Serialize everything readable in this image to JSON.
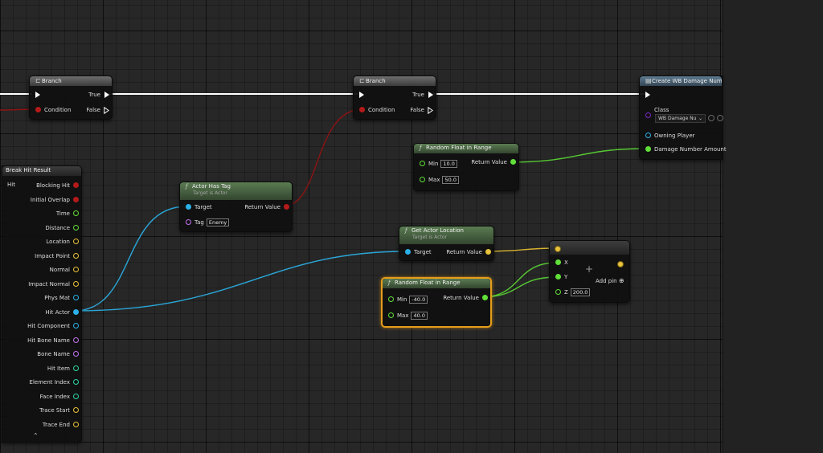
{
  "nodes": {
    "branch1": {
      "title": "Branch",
      "true_label": "True",
      "false_label": "False",
      "condition_label": "Condition"
    },
    "branch2": {
      "title": "Branch",
      "true_label": "True",
      "false_label": "False",
      "condition_label": "Condition"
    },
    "create_widget": {
      "title": "Create WB Damage Numb",
      "class_label": "Class",
      "class_value": "WB Damage Nu",
      "owning_player_label": "Owning Player",
      "damage_amount_label": "Damage Number Amount"
    },
    "random_float_1": {
      "title": "Random Float in Range",
      "min_label": "Min",
      "min_value": "10.0",
      "max_label": "Max",
      "max_value": "50.0",
      "return_label": "Return Value"
    },
    "break_hit_result": {
      "title": "Break Hit Result",
      "input_label": "Hit",
      "outputs": [
        "Blocking Hit",
        "Initial Overlap",
        "Time",
        "Distance",
        "Location",
        "Impact Point",
        "Normal",
        "Impact Normal",
        "Phys Mat",
        "Hit Actor",
        "Hit Component",
        "Hit Bone Name",
        "Bone Name",
        "Hit Item",
        "Element Index",
        "Face Index",
        "Trace Start",
        "Trace End"
      ],
      "collapse_glyph": "⌃"
    },
    "actor_has_tag": {
      "title": "Actor Has Tag",
      "subtitle": "Target is Actor",
      "target_label": "Target",
      "tag_label": "Tag",
      "tag_value": "Enemy",
      "return_label": "Return Value"
    },
    "get_actor_location": {
      "title": "Get Actor Location",
      "subtitle": "Target is Actor",
      "target_label": "Target",
      "return_label": "Return Value"
    },
    "random_float_2": {
      "title": "Random Float in Range",
      "min_label": "Min",
      "min_value": "-40.0",
      "max_label": "Max",
      "max_value": "40.0",
      "return_label": "Return Value"
    },
    "make_vector": {
      "x_label": "X",
      "y_label": "Y",
      "z_label": "Z",
      "z_value": "200.0",
      "add_pin_label": "Add pin",
      "plus_glyph": "+",
      "add_glyph": "⊕"
    }
  },
  "icons": {
    "function": "f-function-icon",
    "branch": "branch-icon",
    "widget": "widget-icon"
  },
  "colors": {
    "exec": "#ffffff",
    "bool": "#b41a1a",
    "float": "#61e03a",
    "vector": "#e7c23b",
    "object": "#2bb1e8",
    "struct": "#2b6cd6",
    "name": "#c275f2",
    "int": "#2fd7a3",
    "class": "#7f26c8",
    "selection": "#e69d1a"
  }
}
